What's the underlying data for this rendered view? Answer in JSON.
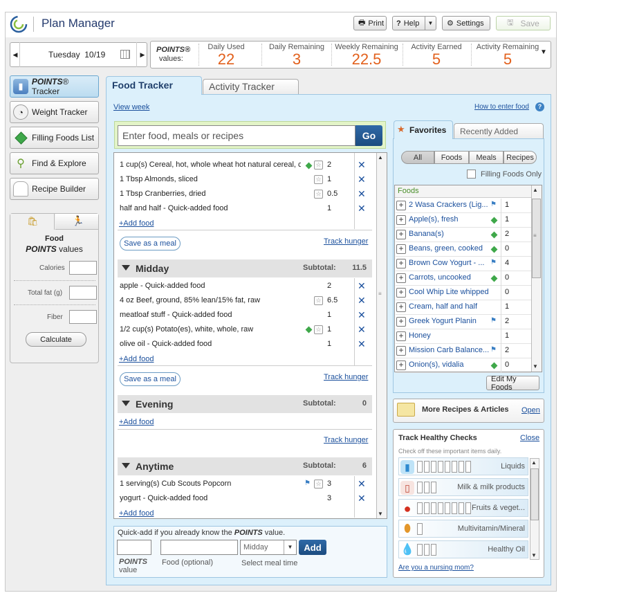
{
  "header": {
    "app_title": "Plan Manager",
    "print_label": "Print",
    "help_label": "Help",
    "settings_label": "Settings",
    "save_label": "Save"
  },
  "datebar": {
    "date": "Tuesday  10/19"
  },
  "points": {
    "label_1": "POINTS®",
    "label_2": "values:",
    "cells": [
      {
        "title": "Daily Used",
        "value": "22"
      },
      {
        "title": "Daily Remaining",
        "value": "3"
      },
      {
        "title": "Weekly Remaining",
        "value": "22.5"
      },
      {
        "title": "Activity Earned",
        "value": "5"
      },
      {
        "title": "Activity Remaining",
        "value": "5"
      }
    ]
  },
  "nav": [
    {
      "label_em": "POINTS",
      "label": "® Tracker",
      "icon": "book-icon"
    },
    {
      "label": "Weight Tracker",
      "icon": "scale-icon"
    },
    {
      "label": "Filling Foods List",
      "icon": "diamond-icon"
    },
    {
      "label": "Find & Explore",
      "icon": "magnifier-icon"
    },
    {
      "label": "Recipe Builder",
      "icon": "chef-hat-icon"
    }
  ],
  "calculator": {
    "title_1": "Food",
    "title_2_em": "POINTS",
    "title_2": " values",
    "calories_label": "Calories",
    "fat_label": "Total fat (g)",
    "fiber_label": "Fiber",
    "calculate_label": "Calculate"
  },
  "tabs": {
    "food": "Food Tracker",
    "activity": "Activity Tracker"
  },
  "links": {
    "view_week": "View week",
    "how_to": "How to enter food",
    "add_food": "+Add food",
    "track_hunger": "Track hunger",
    "save_meal": "Save as a meal"
  },
  "search": {
    "placeholder": "Enter food, meals or recipes",
    "go": "Go"
  },
  "meals": {
    "morning_items": [
      {
        "name": "1 cup(s) Cereal, hot, whole wheat hot natural cereal, c",
        "value": "2"
      },
      {
        "name": "1 Tbsp Almonds, sliced",
        "value": "1"
      },
      {
        "name": "1 Tbsp Cranberries, dried",
        "value": "0.5"
      },
      {
        "name": "half and half - Quick-added food",
        "value": "1"
      }
    ],
    "midday": {
      "name": "Midday",
      "subtotal_label": "Subtotal:",
      "subtotal": "11.5",
      "items": [
        {
          "name": "apple - Quick-added food",
          "value": "2"
        },
        {
          "name": "4 oz Beef, ground, 85% lean/15% fat, raw",
          "value": "6.5"
        },
        {
          "name": "meatloaf stuff - Quick-added food",
          "value": "1"
        },
        {
          "name": "1/2 cup(s) Potato(es), white, whole, raw",
          "value": "1"
        },
        {
          "name": "olive oil - Quick-added food",
          "value": "1"
        }
      ]
    },
    "evening": {
      "name": "Evening",
      "subtotal_label": "Subtotal:",
      "subtotal": "0"
    },
    "anytime": {
      "name": "Anytime",
      "subtotal_label": "Subtotal:",
      "subtotal": "6",
      "items": [
        {
          "name": "1 serving(s) Cub Scouts Popcorn",
          "value": "3"
        },
        {
          "name": "yogurt - Quick-added food",
          "value": "3"
        }
      ]
    }
  },
  "quickadd": {
    "text_1": "Quick-add if you already know the ",
    "text_em": "POINTS",
    "text_2": " value.",
    "meal_select": "Midday",
    "add": "Add",
    "points_label_em": "POINTS",
    "points_label_2": "value",
    "food_label": "Food (optional)",
    "meal_label": "Select meal time"
  },
  "favorites": {
    "tab_active": "Favorites",
    "tab_inactive": "Recently Added",
    "filters": [
      "All",
      "Foods",
      "Meals",
      "Recipes"
    ],
    "filling_only": "Filling Foods Only",
    "list_header": "Foods",
    "items": [
      {
        "name": "2 Wasa Crackers (Lig...",
        "value": "1",
        "mark": "flag"
      },
      {
        "name": "Apple(s), fresh",
        "value": "1",
        "mark": "diamond"
      },
      {
        "name": "Banana(s)",
        "value": "2",
        "mark": "diamond"
      },
      {
        "name": "Beans, green, cooked",
        "value": "0",
        "mark": "diamond"
      },
      {
        "name": "Brown Cow Yogurt - ...",
        "value": "4",
        "mark": "flag"
      },
      {
        "name": "Carrots, uncooked",
        "value": "0",
        "mark": "diamond"
      },
      {
        "name": "Cool Whip Lite whipped t...",
        "value": "0",
        "mark": ""
      },
      {
        "name": "Cream, half and half",
        "value": "1",
        "mark": ""
      },
      {
        "name": "Greek Yogurt Planin",
        "value": "2",
        "mark": "flag"
      },
      {
        "name": "Honey",
        "value": "1",
        "mark": ""
      },
      {
        "name": "Mission Carb Balance...",
        "value": "2",
        "mark": "flag"
      },
      {
        "name": "Onion(s), vidalia",
        "value": "0",
        "mark": "diamond"
      }
    ],
    "edit": "Edit My Foods"
  },
  "recipes": {
    "title": "More Recipes & Articles",
    "open": "Open"
  },
  "healthy": {
    "title": "Track Healthy Checks",
    "close": "Close",
    "subtitle": "Check off these important items daily.",
    "rows": [
      {
        "label": "Liquids",
        "icon": "water-glass-icon"
      },
      {
        "label": "Milk & milk products",
        "icon": "milk-carton-icon"
      },
      {
        "label": "Fruits & veget...",
        "icon": "tomato-icon"
      },
      {
        "label": "Multivitamin/Mineral",
        "icon": "pill-icon"
      },
      {
        "label": "Healthy Oil",
        "icon": "oil-drop-icon"
      }
    ],
    "nursing": "Are you a nursing mom?"
  },
  "colors": {
    "accent_orange": "#e2601c",
    "link_blue": "#1a4f9c",
    "panel_blue": "#dcf0fb",
    "filling_green": "#3fa84a"
  }
}
